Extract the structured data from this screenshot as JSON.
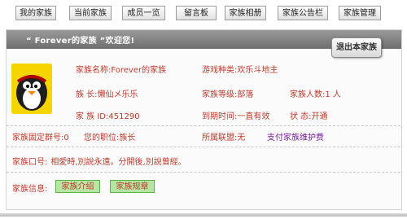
{
  "nav": {
    "items": [
      "我的家族",
      "当前家族",
      "成员一览",
      "留言板",
      "家族相册",
      "家族公告栏",
      "家族管理"
    ]
  },
  "title": {
    "text": "“ Forever的家族 ”欢迎您!",
    "exit_label": "退出本家族"
  },
  "info": {
    "name_label": "家族名称:",
    "name_value": "Forever的家族",
    "game_label": "游戏种类:",
    "game_value": "欢乐斗地主",
    "leader_label": "族 长:",
    "leader_value": "懒仙メ乐乐",
    "level_label": "家族等级:",
    "level_value": "部落",
    "members_label": "家族人数:",
    "members_value": "1 人",
    "id_label": "家 族 ID:",
    "id_value": "451290",
    "expire_label": "到期时间:",
    "expire_value": "一直有效",
    "state_label": "状 态:",
    "state_value": "开通",
    "group_label": "家族固定群号:",
    "group_value": "0",
    "role_label": "您的职位:",
    "role_value": "族长",
    "alliance_label": "所属联盟:",
    "alliance_value": "无",
    "pay_link": "支付家族维护费"
  },
  "slogan": {
    "label": "家族口号:",
    "value": "相愛時,別說永遠。分開後,別說曾經。"
  },
  "footer": {
    "label": "家族信息:",
    "intro_button": "家族介绍",
    "rules_button": "家族规章"
  },
  "colors": {
    "text_red": "#c0392b",
    "link_purple": "#7b1fa2",
    "title_bar": "#808080",
    "button_green": "#b6e6a3"
  }
}
